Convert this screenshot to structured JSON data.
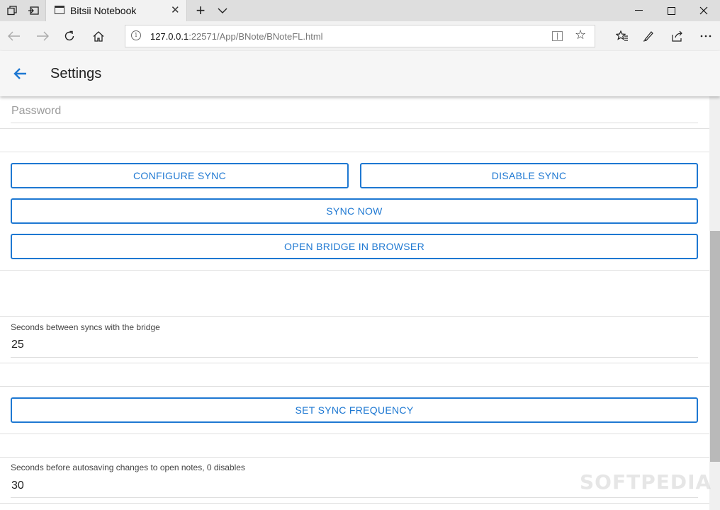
{
  "browser": {
    "tab_title": "Bitsii Notebook",
    "url_host": "127.0.0.1",
    "url_rest": ":22571/App/BNote/BNoteFL.html"
  },
  "app": {
    "title": "Settings"
  },
  "password": {
    "placeholder": "Password"
  },
  "buttons": {
    "configure_sync": "CONFIGURE SYNC",
    "disable_sync": "DISABLE SYNC",
    "sync_now": "SYNC NOW",
    "open_bridge": "OPEN BRIDGE IN BROWSER",
    "set_sync_frequency": "SET SYNC FREQUENCY"
  },
  "sync_interval": {
    "label": "Seconds between syncs with the bridge",
    "value": "25"
  },
  "autosave": {
    "label": "Seconds before autosaving changes to open notes, 0 disables",
    "value": "30"
  },
  "watermark": "SOFTPEDIA",
  "colors": {
    "accent": "#1e78d2"
  },
  "icons": {
    "back": "arrow-left-icon",
    "tab_preview": "tabs-aside-icon",
    "refresh": "refresh-icon",
    "home": "home-icon",
    "favorite": "star-icon",
    "favorites_hub": "favorites-icon",
    "notes": "pen-icon",
    "share": "share-icon",
    "more": "more-icon"
  }
}
